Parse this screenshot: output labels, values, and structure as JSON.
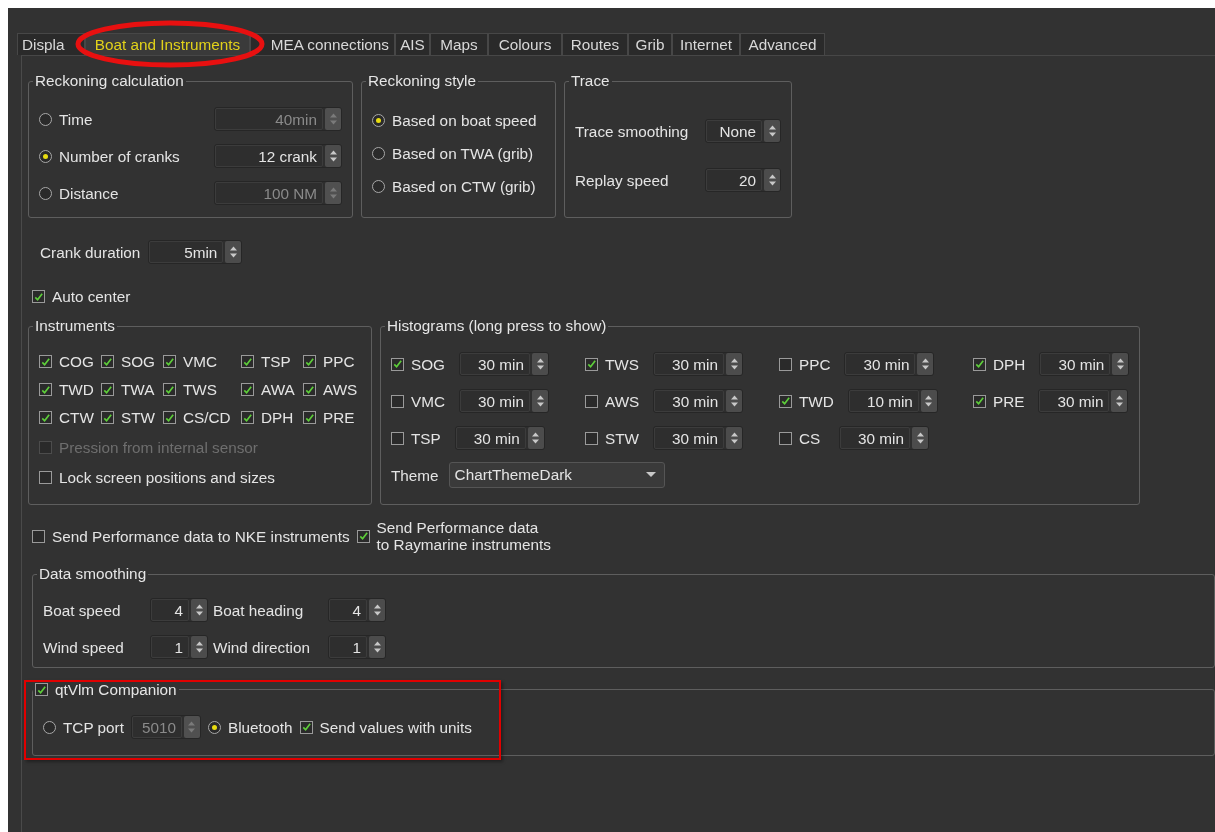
{
  "tabs": [
    {
      "label": "Displa",
      "selected": false
    },
    {
      "label": "Boat and Instruments",
      "selected": true
    },
    {
      "label": "MEA connections",
      "selected": false
    },
    {
      "label": "AIS",
      "selected": false
    },
    {
      "label": "Maps",
      "selected": false
    },
    {
      "label": "Colours",
      "selected": false
    },
    {
      "label": "Routes",
      "selected": false
    },
    {
      "label": "Grib",
      "selected": false
    },
    {
      "label": "Internet",
      "selected": false
    },
    {
      "label": "Advanced",
      "selected": false
    }
  ],
  "reckoning_calculation": {
    "title": "Reckoning calculation",
    "options": [
      {
        "label": "Time",
        "selected": false,
        "value": "40min",
        "disabled": true
      },
      {
        "label": "Number of cranks",
        "selected": true,
        "value": "12 crank",
        "disabled": false
      },
      {
        "label": "Distance",
        "selected": false,
        "value": "100 NM",
        "disabled": true
      }
    ]
  },
  "reckoning_style": {
    "title": "Reckoning style",
    "options": [
      {
        "label": "Based on boat speed",
        "selected": true
      },
      {
        "label": "Based on TWA (grib)",
        "selected": false
      },
      {
        "label": "Based on CTW (grib)",
        "selected": false
      }
    ]
  },
  "trace": {
    "title": "Trace",
    "fields": [
      {
        "label": "Trace smoothing",
        "value": "None"
      },
      {
        "label": "Replay speed",
        "value": "20"
      }
    ]
  },
  "crank_duration": {
    "label": "Crank duration",
    "value": "5min"
  },
  "auto_center": {
    "label": "Auto center",
    "checked": true
  },
  "instruments": {
    "title": "Instruments",
    "items": [
      {
        "label": "COG",
        "checked": true
      },
      {
        "label": "SOG",
        "checked": true
      },
      {
        "label": "VMC",
        "checked": true
      },
      {
        "label": "TSP",
        "checked": true
      },
      {
        "label": "PPC",
        "checked": true
      },
      {
        "label": "TWD",
        "checked": true
      },
      {
        "label": "TWA",
        "checked": true
      },
      {
        "label": "TWS",
        "checked": true
      },
      {
        "label": "AWA",
        "checked": true
      },
      {
        "label": "AWS",
        "checked": true
      },
      {
        "label": "CTW",
        "checked": true
      },
      {
        "label": "STW",
        "checked": true
      },
      {
        "label": "CS/CD",
        "checked": true
      },
      {
        "label": "DPH",
        "checked": true
      },
      {
        "label": "PRE",
        "checked": true
      }
    ],
    "options": [
      {
        "label": "Pression from internal sensor",
        "checked": false,
        "disabled": true
      },
      {
        "label": "Lock screen positions and sizes",
        "checked": false,
        "disabled": false
      }
    ]
  },
  "histograms": {
    "title": "Histograms (long press to show)",
    "items": [
      {
        "label": "SOG",
        "checked": true,
        "value": "30 min"
      },
      {
        "label": "TWS",
        "checked": true,
        "value": "30 min"
      },
      {
        "label": "PPC",
        "checked": false,
        "value": "30 min"
      },
      {
        "label": "DPH",
        "checked": true,
        "value": "30 min"
      },
      {
        "label": "VMC",
        "checked": false,
        "value": "30 min"
      },
      {
        "label": "AWS",
        "checked": false,
        "value": "30 min"
      },
      {
        "label": "TWD",
        "checked": true,
        "value": "10 min"
      },
      {
        "label": "PRE",
        "checked": true,
        "value": "30 min"
      },
      {
        "label": "TSP",
        "checked": false,
        "value": "30 min"
      },
      {
        "label": "STW",
        "checked": false,
        "value": "30 min"
      },
      {
        "label": "CS",
        "checked": false,
        "value": "30 min"
      }
    ],
    "theme": {
      "label": "Theme",
      "value": "ChartThemeDark"
    }
  },
  "performance": [
    {
      "label": "Send Performance data to NKE instruments",
      "checked": false
    },
    {
      "label": "Send Performance data\nto Raymarine instruments",
      "checked": true
    }
  ],
  "data_smoothing": {
    "title": "Data smoothing",
    "fields": [
      {
        "label": "Boat speed",
        "value": "4"
      },
      {
        "label": "Boat heading",
        "value": "4"
      },
      {
        "label": "Wind speed",
        "value": "1"
      },
      {
        "label": "Wind direction",
        "value": "1"
      }
    ]
  },
  "companion": {
    "title": "qtVlm Companion",
    "checked": true,
    "tcp": {
      "label": "TCP port",
      "selected": false,
      "value": "5010",
      "disabled": true
    },
    "bluetooth": {
      "label": "Bluetooth",
      "selected": true
    },
    "units": {
      "label": "Send values with units",
      "checked": true
    }
  }
}
